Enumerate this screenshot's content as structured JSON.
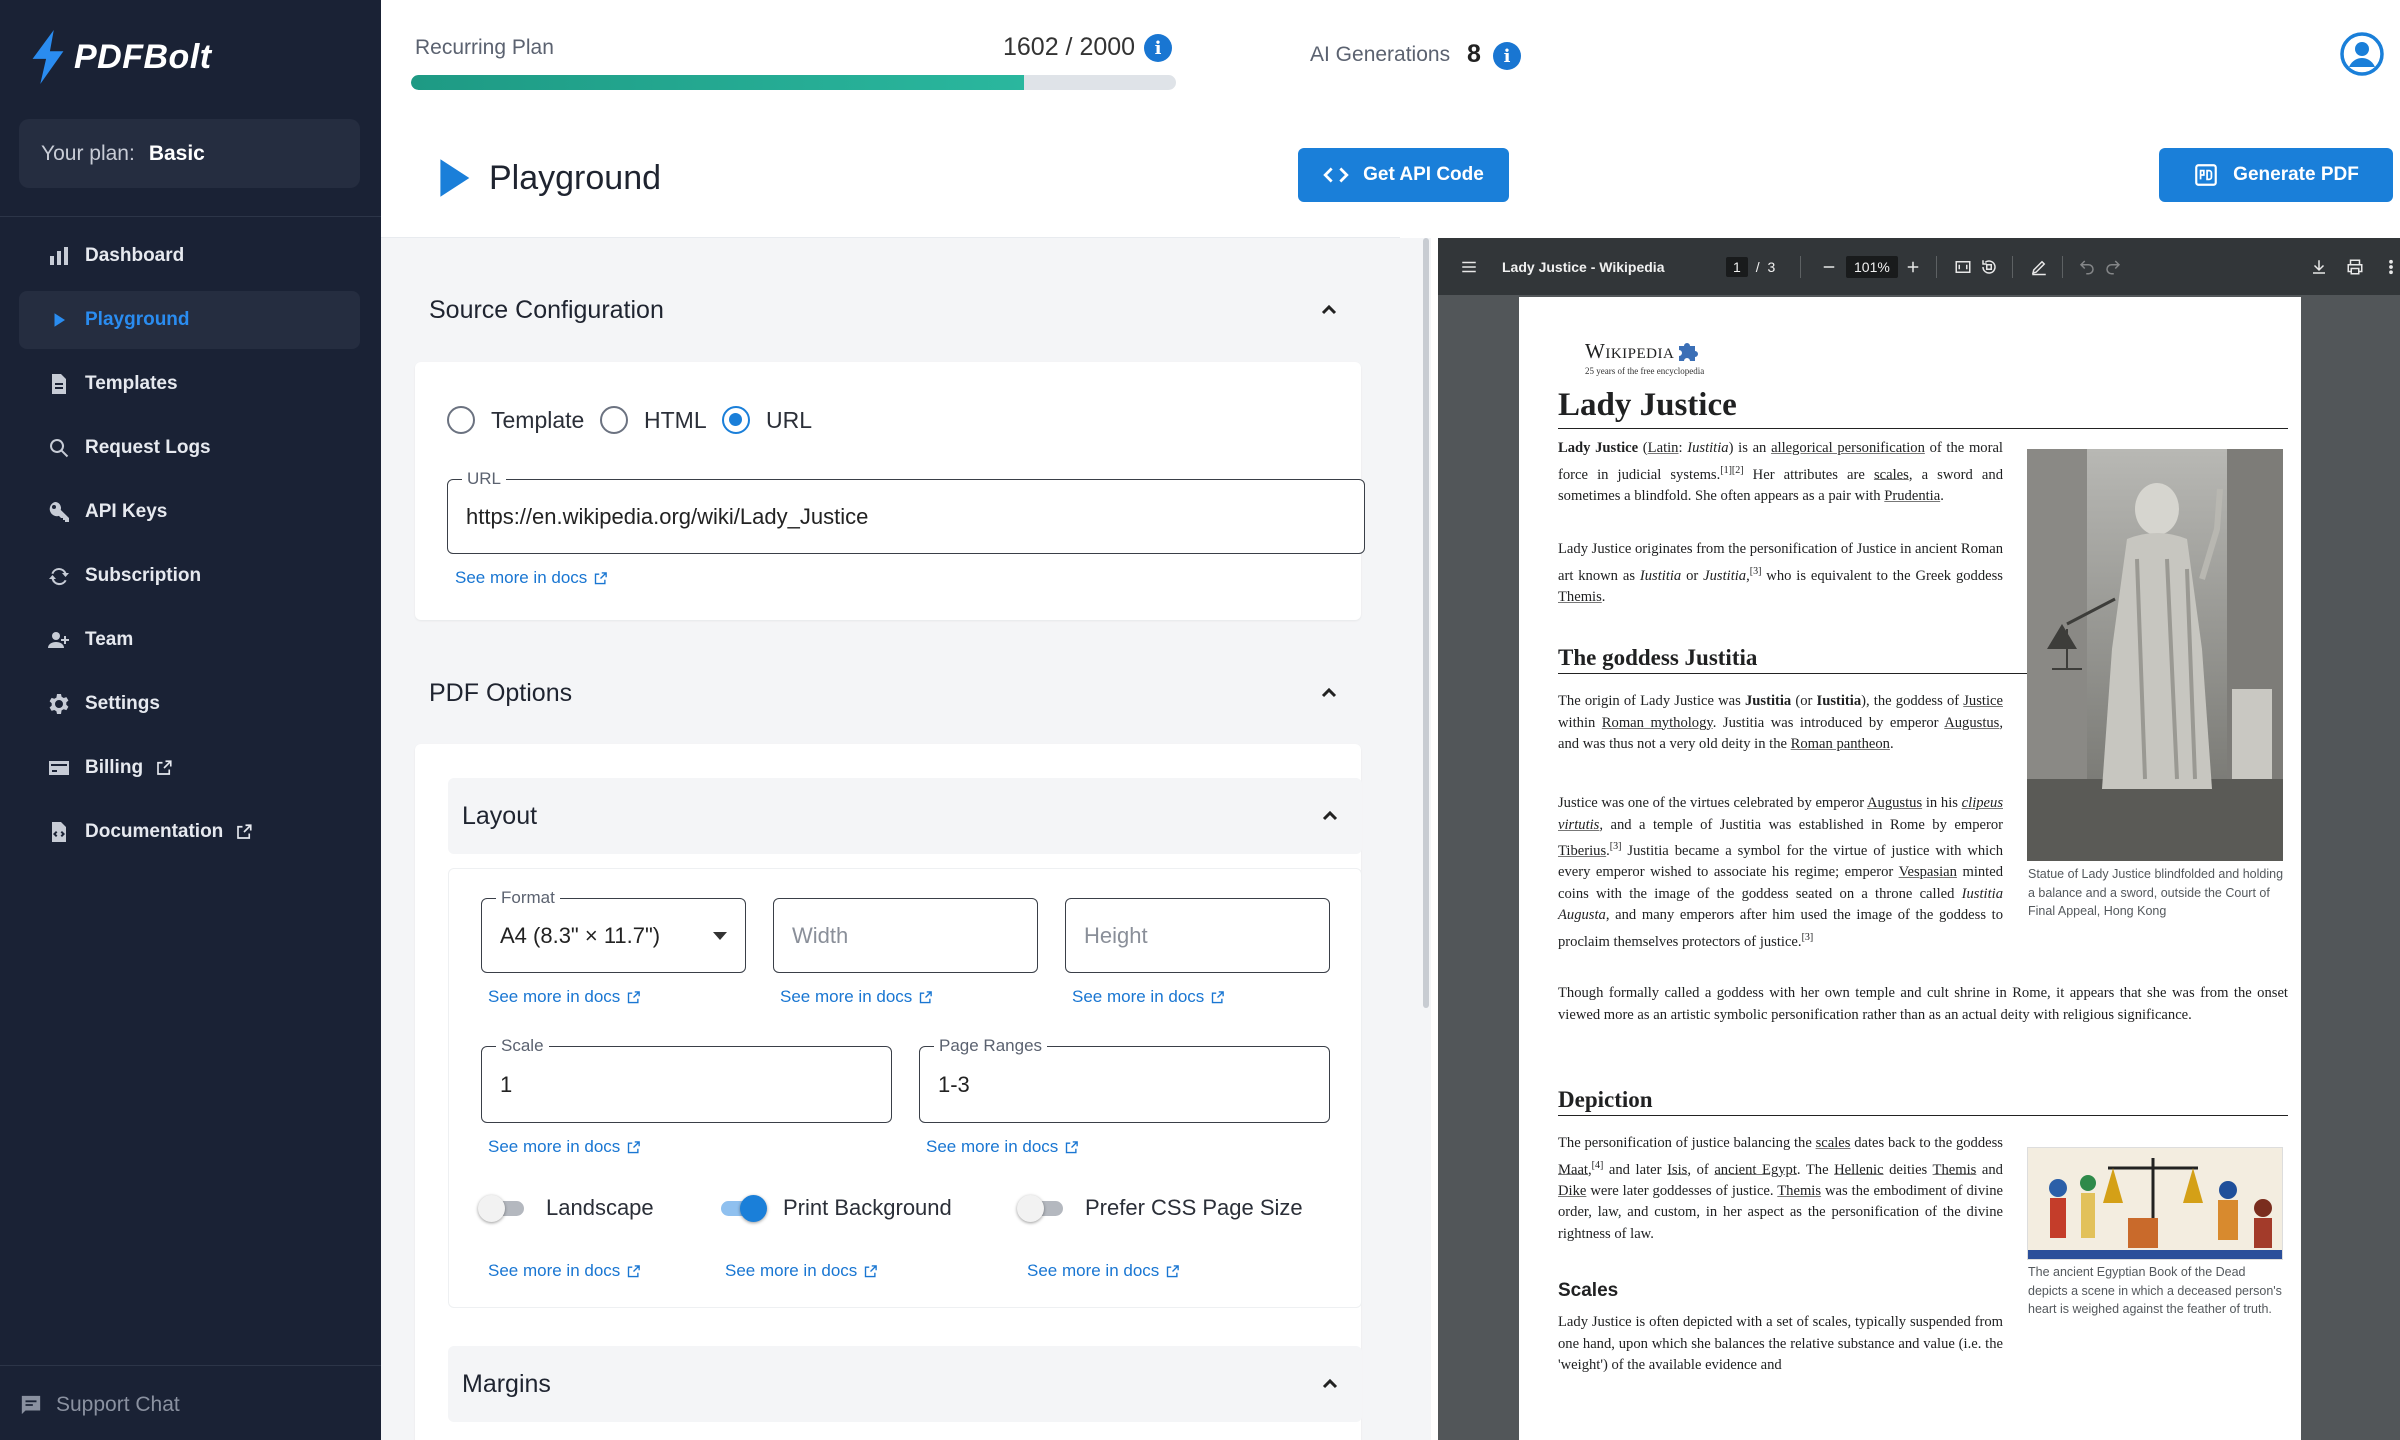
{
  "app": {
    "name": "PDFBolt"
  },
  "sidebar": {
    "plan_label": "Your plan:",
    "plan_value": "Basic",
    "items": [
      {
        "label": "Dashboard",
        "icon": "bar-chart-icon"
      },
      {
        "label": "Playground",
        "icon": "play-icon"
      },
      {
        "label": "Templates",
        "icon": "document-icon"
      },
      {
        "label": "Request Logs",
        "icon": "search-icon"
      },
      {
        "label": "API Keys",
        "icon": "key-icon"
      },
      {
        "label": "Subscription",
        "icon": "refresh-icon"
      },
      {
        "label": "Team",
        "icon": "team-icon"
      },
      {
        "label": "Settings",
        "icon": "gear-icon"
      },
      {
        "label": "Billing",
        "icon": "credit-card-icon"
      },
      {
        "label": "Documentation",
        "icon": "docs-icon"
      }
    ],
    "support": "Support Chat"
  },
  "topbar": {
    "plan_label": "Recurring Plan",
    "plan_used": "1602 / 2000",
    "plan_progress": 0.801,
    "ai_label": "AI Generations",
    "ai_count": "8"
  },
  "header": {
    "title": "Playground",
    "api_button": "Get API Code",
    "generate_button": "Generate PDF"
  },
  "source": {
    "title": "Source Configuration",
    "options": [
      "Template",
      "HTML",
      "URL"
    ],
    "selected": "URL",
    "url_label": "URL",
    "url_value": "https://en.wikipedia.org/wiki/Lady_Justice",
    "docs": "See more in docs"
  },
  "pdf_options": {
    "title": "PDF Options",
    "layout": {
      "title": "Layout",
      "format_label": "Format",
      "format_value": "A4 (8.3\" × 11.7\")",
      "width_placeholder": "Width",
      "height_placeholder": "Height",
      "scale_label": "Scale",
      "scale_value": "1",
      "ranges_label": "Page Ranges",
      "ranges_value": "1-3",
      "landscape": "Landscape",
      "print_background": "Print Background",
      "prefer_css": "Prefer CSS Page Size",
      "docs": "See more in docs"
    },
    "margins_title": "Margins"
  },
  "viewer": {
    "doc_title": "Lady Justice - Wikipedia",
    "page_current": "1",
    "page_sep": "/",
    "page_total": "3",
    "zoom": "101%"
  },
  "article": {
    "wiki_name": "Wikipedia",
    "wiki_tagline": "25 years of the free encyclopedia",
    "title": "Lady Justice",
    "h_goddess": "The goddess Justitia",
    "h_depiction": "Depiction",
    "h_scales": "Scales",
    "caption1": "Statue of Lady Justice blindfolded and holding a balance and a sword, outside the Court of Final Appeal, Hong Kong",
    "caption2": "The ancient Egyptian Book of the Dead depicts a scene in which a deceased person's heart is weighed against the feather of truth."
  }
}
